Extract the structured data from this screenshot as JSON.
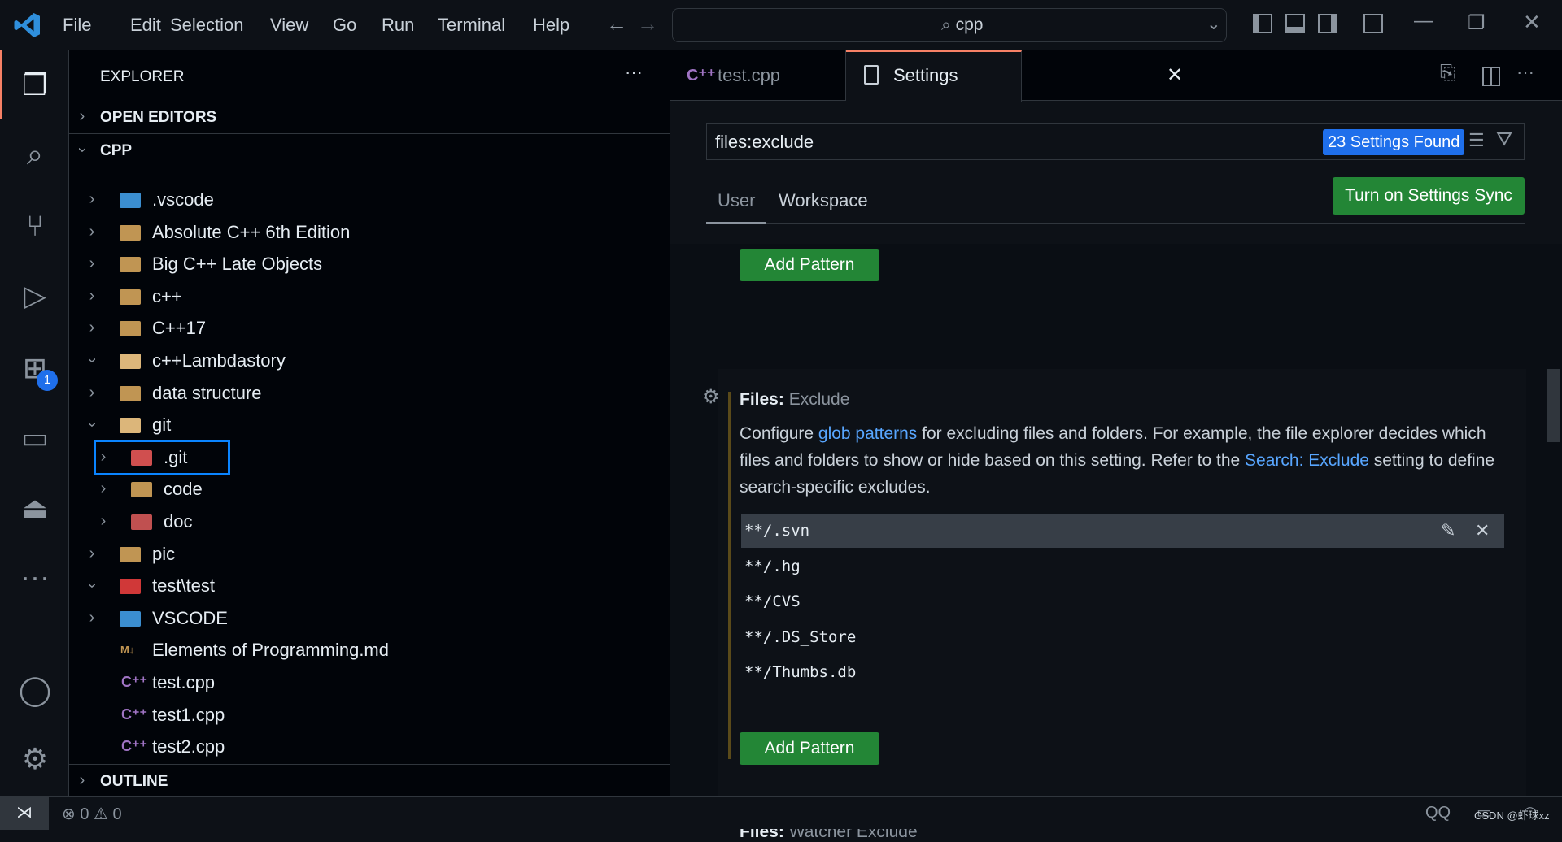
{
  "menu": [
    "File",
    "Edit",
    "Selection",
    "View",
    "Go",
    "Run",
    "Terminal",
    "Help"
  ],
  "command_center": "cpp",
  "explorer": {
    "title": "EXPLORER",
    "open_editors": "OPEN EDITORS",
    "root": "CPP",
    "outline": "OUTLINE",
    "tree": [
      {
        "label": ".vscode",
        "depth": 0,
        "state": "collapsed",
        "icon": "vscode-folder-icon"
      },
      {
        "label": "Absolute C++ 6th Edition",
        "depth": 0,
        "state": "collapsed",
        "icon": "folder-icon"
      },
      {
        "label": "Big C++ Late Objects",
        "depth": 0,
        "state": "collapsed",
        "icon": "folder-icon"
      },
      {
        "label": "c++",
        "depth": 0,
        "state": "collapsed",
        "icon": "folder-icon"
      },
      {
        "label": "C++17",
        "depth": 0,
        "state": "collapsed",
        "icon": "folder-icon"
      },
      {
        "label": "c++Lambdastory",
        "depth": 0,
        "state": "expanded",
        "icon": "folder-open-icon"
      },
      {
        "label": "data structure",
        "depth": 0,
        "state": "collapsed",
        "icon": "folder-icon"
      },
      {
        "label": "git",
        "depth": 0,
        "state": "expanded",
        "icon": "folder-open-icon"
      },
      {
        "label": ".git",
        "depth": 1,
        "state": "collapsed",
        "icon": "git-folder-icon",
        "highlighted": true
      },
      {
        "label": "code",
        "depth": 1,
        "state": "collapsed",
        "icon": "folder-icon"
      },
      {
        "label": "doc",
        "depth": 1,
        "state": "collapsed",
        "icon": "doc-folder-icon"
      },
      {
        "label": "pic",
        "depth": 0,
        "state": "collapsed",
        "icon": "folder-icon"
      },
      {
        "label": "test\\test",
        "depth": 0,
        "state": "expanded",
        "icon": "test-folder-icon"
      },
      {
        "label": "VSCODE",
        "depth": 0,
        "state": "collapsed",
        "icon": "vscode-folder-icon"
      },
      {
        "label": "Elements of Programming.md",
        "depth": 0,
        "state": "file",
        "icon": "markdown-icon"
      },
      {
        "label": "test.cpp",
        "depth": 0,
        "state": "file",
        "icon": "cpp-icon"
      },
      {
        "label": "test1.cpp",
        "depth": 0,
        "state": "file",
        "icon": "cpp-icon"
      },
      {
        "label": "test2.cpp",
        "depth": 0,
        "state": "file",
        "icon": "cpp-icon"
      }
    ]
  },
  "extensions_badge": "1",
  "tabs": [
    {
      "label": "test.cpp",
      "active": false
    },
    {
      "label": "Settings",
      "active": true
    }
  ],
  "settings": {
    "search_value": "files:exclude",
    "found": "23 Settings Found",
    "scope_tabs": [
      "User",
      "Workspace"
    ],
    "sync_button": "Turn on Settings Sync",
    "add_pattern": "Add Pattern",
    "setting_category": "Files: ",
    "setting_name": "Exclude",
    "desc": {
      "p1": "Configure ",
      "link1": "glob patterns",
      "p2": " for excluding files and folders. For example, the file explorer decides which files and folders to show or hide based on this setting. Refer to the ",
      "link2": "Search: Exclude",
      "p3": " setting to define search-specific excludes."
    },
    "patterns": [
      "**/.svn",
      "**/.hg",
      "**/CVS",
      "**/.DS_Store",
      "**/Thumbs.db"
    ],
    "next_category": "Files: ",
    "next_name": "Watcher Exclude"
  },
  "status": {
    "errors": "0",
    "warnings": "0",
    "qq": "QQ",
    "watermark": "CSDN @虾球xz"
  },
  "colors": {
    "accent": "#1f6feb",
    "green": "#238636",
    "link": "#58a6ff",
    "tab_active_border": "#f78166"
  }
}
